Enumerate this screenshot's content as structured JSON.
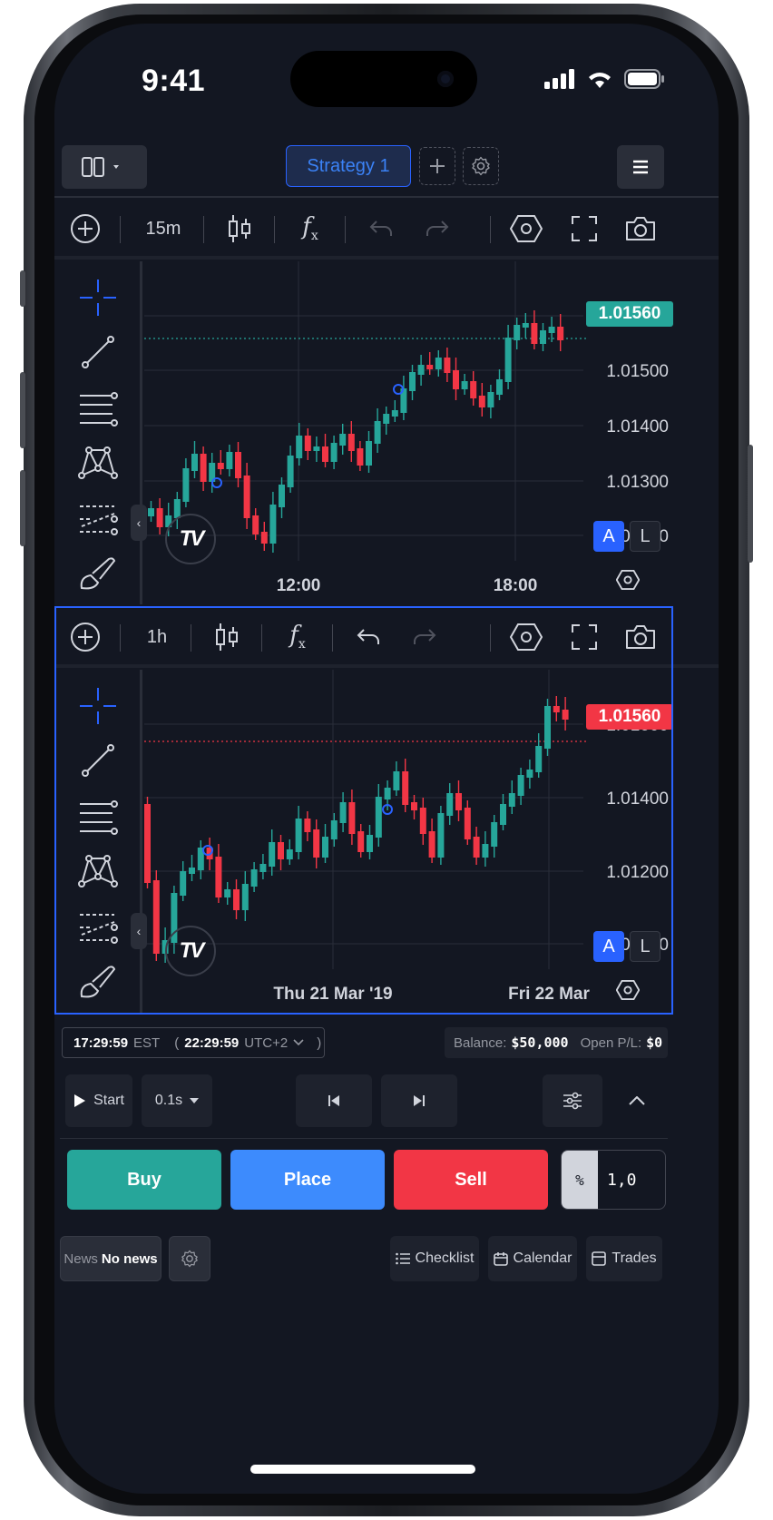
{
  "status_bar": {
    "time": "9:41"
  },
  "header": {
    "strategy_tab": "Strategy 1"
  },
  "top_chart": {
    "interval": "15m",
    "last_price": "1.01560",
    "price_axis": [
      "1.01600",
      "1.01500",
      "1.01400",
      "1.01300",
      "1.01200"
    ],
    "time_axis": [
      "12:00",
      "18:00"
    ],
    "auto_label": "A",
    "log_label": "L",
    "last_price_color": "#26a69a"
  },
  "bottom_chart": {
    "interval": "1h",
    "last_price": "1.01560",
    "price_axis": [
      "1.01600",
      "1.01400",
      "1.01200",
      "1.01000"
    ],
    "time_axis": [
      "Thu 21 Mar '19",
      "Fri 22 Mar"
    ],
    "auto_label": "A",
    "log_label": "L",
    "last_price_color": "#f23645"
  },
  "clock": {
    "time1": "17:29:59",
    "tz1": "EST",
    "time2": "22:29:59",
    "tz2": "UTC+2",
    "open_paren": "(",
    "close_paren": ")"
  },
  "account": {
    "balance_label": "Balance:",
    "balance": "$50,000",
    "pl_label": "Open P/L:",
    "pl": "$0"
  },
  "replay": {
    "start_label": "Start",
    "speed": "0.1s"
  },
  "order": {
    "buy_label": "Buy",
    "place_label": "Place",
    "sell_label": "Sell",
    "unit": "%",
    "quantity": "1,0"
  },
  "footer": {
    "news_prefix": "News",
    "news_value": "No news",
    "checklist": "Checklist",
    "calendar": "Calendar",
    "trades": "Trades"
  },
  "colors": {
    "up": "#26a69a",
    "down": "#f23645",
    "accent": "#2962ff",
    "background": "#131722"
  }
}
